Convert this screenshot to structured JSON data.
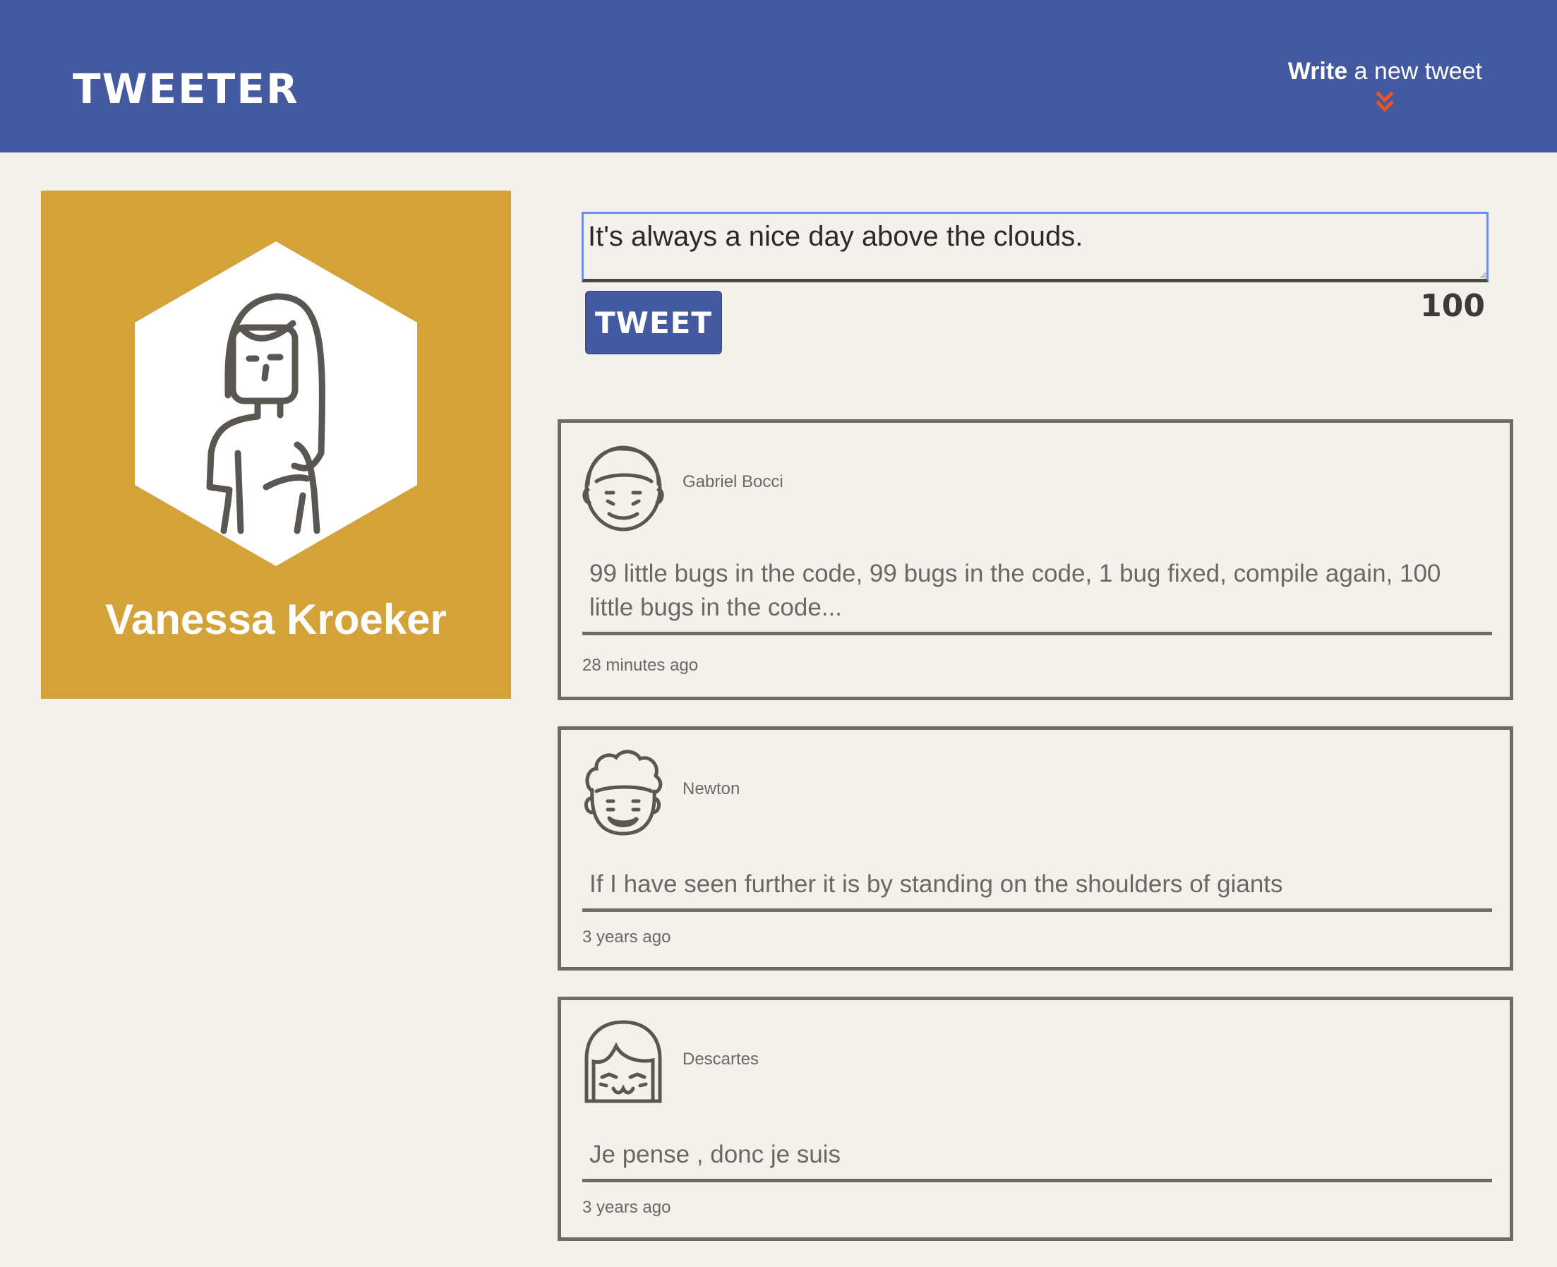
{
  "nav": {
    "brand": "TWEETER",
    "compose_toggle_bold": "Write",
    "compose_toggle_rest": " a new tweet"
  },
  "profile": {
    "name": "Vanessa Kroeker",
    "avatar_icon": "woman-avatar-icon"
  },
  "composer": {
    "text": "It's always a nice day above the clouds.",
    "button_label": "TWEET",
    "counter": "100"
  },
  "tweets": [
    {
      "author": "Gabriel Bocci",
      "avatar_icon": "smiling-man-avatar-icon",
      "content": "99 little bugs in the code, 99 bugs in the code, 1 bug fixed, compile again, 100 little bugs in the code...",
      "timestamp": "28 minutes ago"
    },
    {
      "author": "Newton",
      "avatar_icon": "curly-hair-man-avatar-icon",
      "content": "If I have seen further it is by standing on the shoulders of giants",
      "timestamp": "3 years ago"
    },
    {
      "author": "Descartes",
      "avatar_icon": "bob-hair-woman-avatar-icon",
      "content": "Je pense , donc je suis",
      "timestamp": "3 years ago"
    }
  ],
  "colors": {
    "nav_bg": "#4359a0",
    "page_bg": "#f4f1ec",
    "profile_bg": "#d3a239",
    "accent_chevron": "#e4562a",
    "border": "#6e6b66"
  }
}
